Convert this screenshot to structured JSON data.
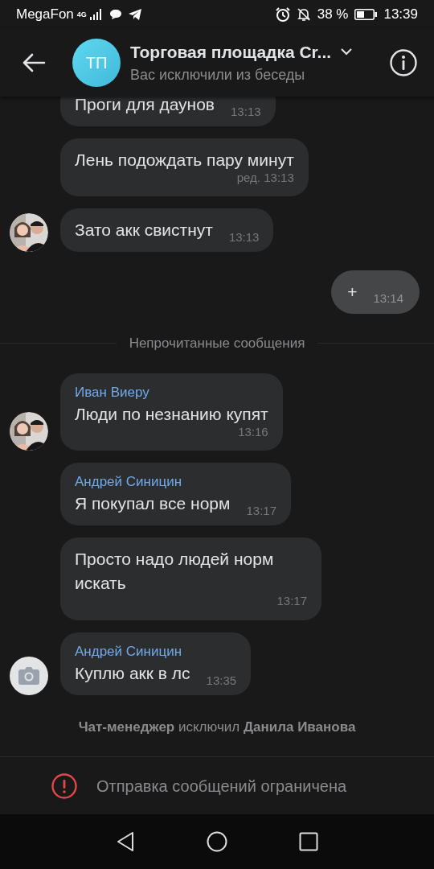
{
  "status_bar": {
    "carrier": "MegaFon",
    "network": "4G",
    "battery": "38 %",
    "time": "13:39"
  },
  "header": {
    "avatar_initials": "ТП",
    "title": "Торговая площадка Cr...",
    "subtitle": "Вас исключили из беседы"
  },
  "messages": [
    {
      "kind": "incoming",
      "text": "Проги для даунов",
      "time": "13:13",
      "block_time": false
    },
    {
      "kind": "incoming",
      "text": "Лень подождать пару минут",
      "time": "ред. 13:13",
      "block_time": true
    },
    {
      "kind": "incoming",
      "text": "Зато акк свистнут",
      "time": "13:13",
      "block_time": false
    },
    {
      "kind": "outgoing",
      "text": "+",
      "time": "13:14"
    },
    {
      "kind": "divider",
      "text": "Непрочитанные сообщения"
    },
    {
      "kind": "incoming",
      "sender": "Иван Виеру",
      "text": "Люди по незнанию купят",
      "time": "13:16",
      "block_time": true
    },
    {
      "kind": "incoming",
      "sender": "Андрей Синицин",
      "text": "Я покупал все норм",
      "time": "13:17",
      "block_time": false
    },
    {
      "kind": "incoming",
      "text": "Просто надо людей норм искать",
      "time": "13:17",
      "block_time": true
    },
    {
      "kind": "incoming",
      "avatar": {
        "kind": "camera"
      },
      "sender": "Андрей Синицин",
      "text": "Куплю акк в лс",
      "time": "13:35",
      "block_time": false
    },
    {
      "kind": "system",
      "text": "**Чат-менеджер** исключил **Данила Иванова**"
    }
  ],
  "restriction": {
    "text": "Отправка сообщений ограничена"
  }
}
